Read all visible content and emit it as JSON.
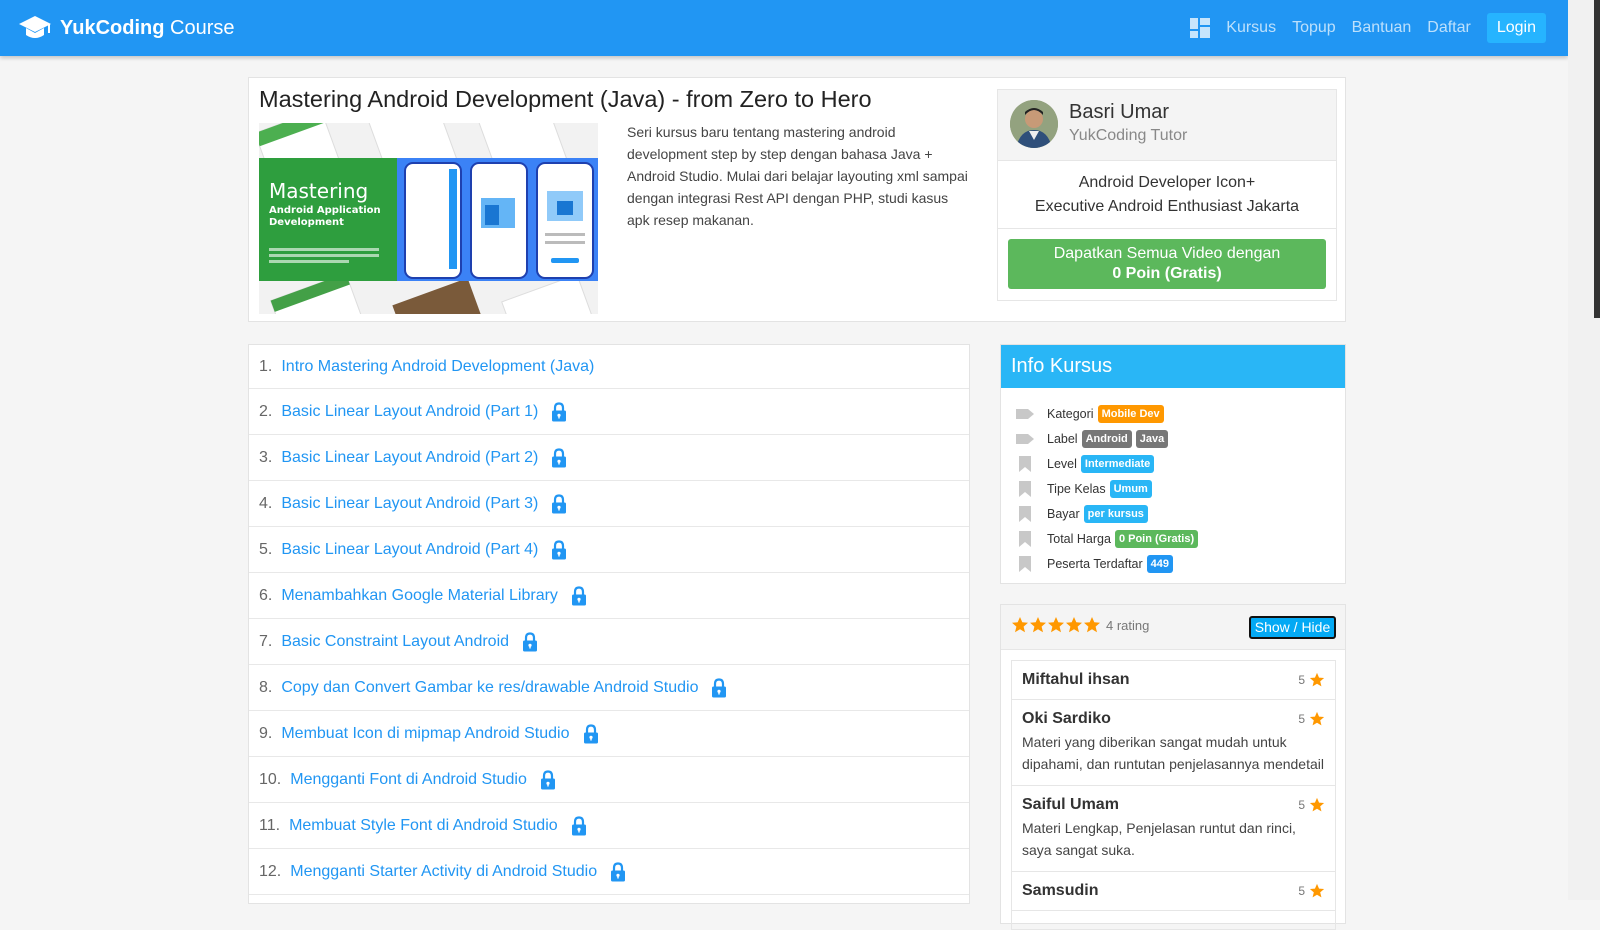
{
  "nav": {
    "brand_bold": "YukCoding",
    "brand_rest": " Course",
    "links": [
      "Kursus",
      "Topup",
      "Bantuan",
      "Daftar"
    ],
    "login": "Login",
    "brand_color": "#2196f3"
  },
  "course": {
    "title": "Mastering Android Development (Java) - from Zero to Hero",
    "description": "Seri kursus baru tentang mastering android development step by step dengan bahasa Java + Android Studio. Mulai dari belajar layouting xml sampai dengan integrasi Rest API dengan PHP, studi kasus apk resep makanan.",
    "thumb_text": {
      "line1": "Mastering",
      "line2": "Android Application",
      "line3": "Development"
    }
  },
  "tutor": {
    "name": "Basri Umar",
    "role": "YukCoding Tutor",
    "bio_line1": "Android Developer Icon+",
    "bio_line2": "Executive Android Enthusiast Jakarta",
    "cta_line1": "Dapatkan Semua Video dengan",
    "cta_line2": "0 Poin (Gratis)"
  },
  "lessons": [
    {
      "num": "1.",
      "title": "Intro Mastering Android Development (Java)",
      "locked": false
    },
    {
      "num": "2.",
      "title": "Basic Linear Layout Android (Part 1)",
      "locked": true
    },
    {
      "num": "3.",
      "title": "Basic Linear Layout Android (Part 2)",
      "locked": true
    },
    {
      "num": "4.",
      "title": "Basic Linear Layout Android (Part 3)",
      "locked": true
    },
    {
      "num": "5.",
      "title": "Basic Linear Layout Android (Part 4)",
      "locked": true
    },
    {
      "num": "6.",
      "title": "Menambahkan Google Material Library",
      "locked": true
    },
    {
      "num": "7.",
      "title": "Basic Constraint Layout Android",
      "locked": true
    },
    {
      "num": "8.",
      "title": "Copy dan Convert Gambar ke res/drawable Android Studio",
      "locked": true
    },
    {
      "num": "9.",
      "title": "Membuat Icon di mipmap Android Studio",
      "locked": true
    },
    {
      "num": "10.",
      "title": "Mengganti Font di Android Studio",
      "locked": true
    },
    {
      "num": "11.",
      "title": "Membuat Style Font di Android Studio",
      "locked": true
    },
    {
      "num": "12.",
      "title": "Mengganti Starter Activity di Android Studio",
      "locked": true
    }
  ],
  "info": {
    "title": "Info Kursus",
    "rows": [
      {
        "label": "Kategori",
        "icon": "tag-icon",
        "badges": [
          {
            "text": "Mobile Dev",
            "color": "#ff9800"
          }
        ]
      },
      {
        "label": "Label",
        "icon": "tag-icon",
        "badges": [
          {
            "text": "Android",
            "color": "#777777"
          },
          {
            "text": "Java",
            "color": "#777777"
          }
        ]
      },
      {
        "label": "Level",
        "icon": "bookmark-icon",
        "badges": [
          {
            "text": "Intermediate",
            "color": "#29b6f6"
          }
        ]
      },
      {
        "label": "Tipe Kelas",
        "icon": "bookmark-icon",
        "badges": [
          {
            "text": "Umum",
            "color": "#29b6f6"
          }
        ]
      },
      {
        "label": "Bayar",
        "icon": "bookmark-icon",
        "badges": [
          {
            "text": "per kursus",
            "color": "#29b6f6"
          }
        ]
      },
      {
        "label": "Total Harga",
        "icon": "bookmark-icon",
        "badges": [
          {
            "text": "0 Poin (Gratis)",
            "color": "#5cb85c"
          }
        ]
      },
      {
        "label": "Peserta Terdaftar",
        "icon": "bookmark-icon",
        "badges": [
          {
            "text": "449",
            "color": "#2196f3"
          }
        ]
      }
    ]
  },
  "rating": {
    "stars": 5,
    "count_label": "4 rating",
    "toggle": "Show / Hide",
    "reviews": [
      {
        "name": "Miftahul ihsan",
        "score": "5",
        "text": ""
      },
      {
        "name": "Oki Sardiko",
        "score": "5",
        "text": "Materi yang diberikan sangat mudah untuk dipahami, dan runtutan penjelasannya mendetail"
      },
      {
        "name": "Saiful Umam",
        "score": "5",
        "text": "Materi Lengkap, Penjelasan runtut dan rinci, saya sangat suka."
      },
      {
        "name": "Samsudin",
        "score": "5",
        "text": ""
      }
    ]
  },
  "colors": {
    "accent": "#2196f3",
    "info_header": "#29b6f6",
    "success": "#5cb85c",
    "star": "#ff9800"
  }
}
